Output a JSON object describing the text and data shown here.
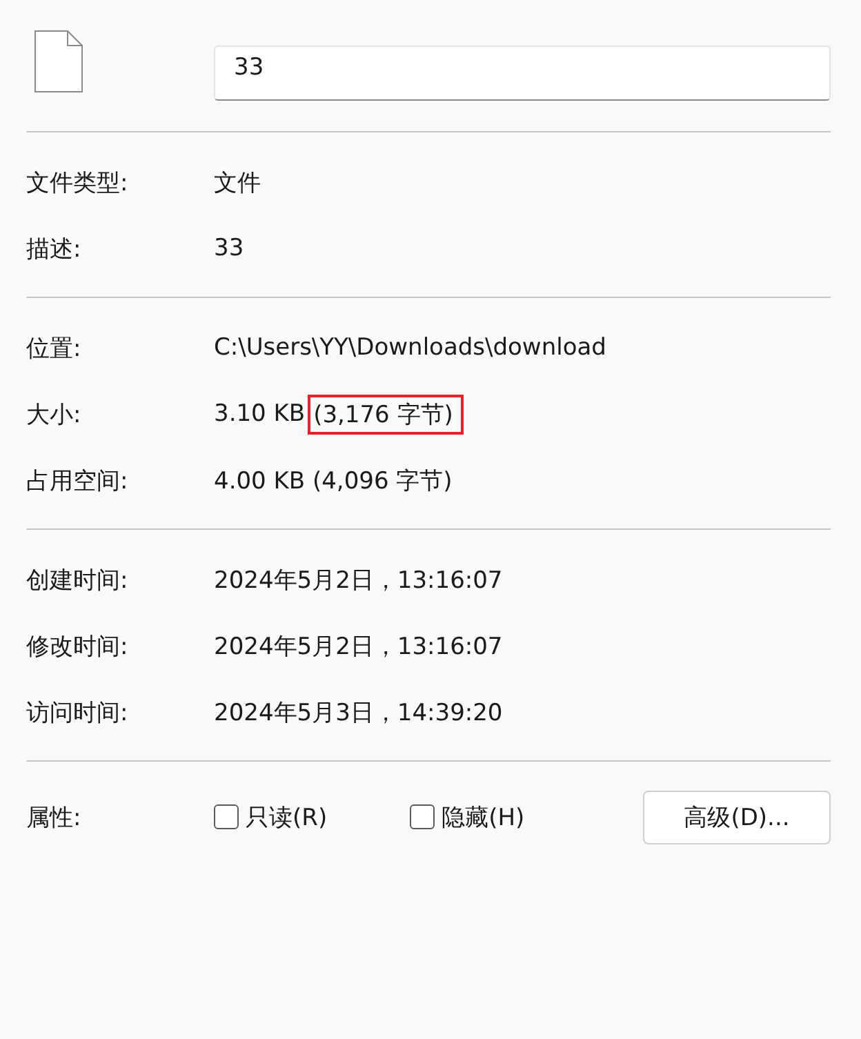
{
  "file": {
    "name": "33"
  },
  "sections": [
    {
      "rows": [
        {
          "label": "文件类型:",
          "value": "文件"
        },
        {
          "label": "描述:",
          "value": "33"
        }
      ]
    },
    {
      "rows": [
        {
          "label": "位置:",
          "value": "C:\\Users\\YY\\Downloads\\download"
        },
        {
          "label": "大小:",
          "value": "3.10 KB",
          "note": {
            "text": "(3,176 字节)",
            "highlighted": true
          }
        },
        {
          "label": "占用空间:",
          "value": "4.00 KB (4,096 字节)"
        }
      ]
    },
    {
      "rows": [
        {
          "label": "创建时间:",
          "value": "2024年5月2日，13:16:07"
        },
        {
          "label": "修改时间:",
          "value": "2024年5月2日，13:16:07"
        },
        {
          "label": "访问时间:",
          "value": "2024年5月3日，14:39:20"
        }
      ]
    }
  ],
  "attributes": {
    "label": "属性:",
    "options": [
      {
        "label": "只读(R)",
        "checked": false
      },
      {
        "label": "隐藏(H)",
        "checked": false
      }
    ],
    "button": "高级(D)..."
  }
}
